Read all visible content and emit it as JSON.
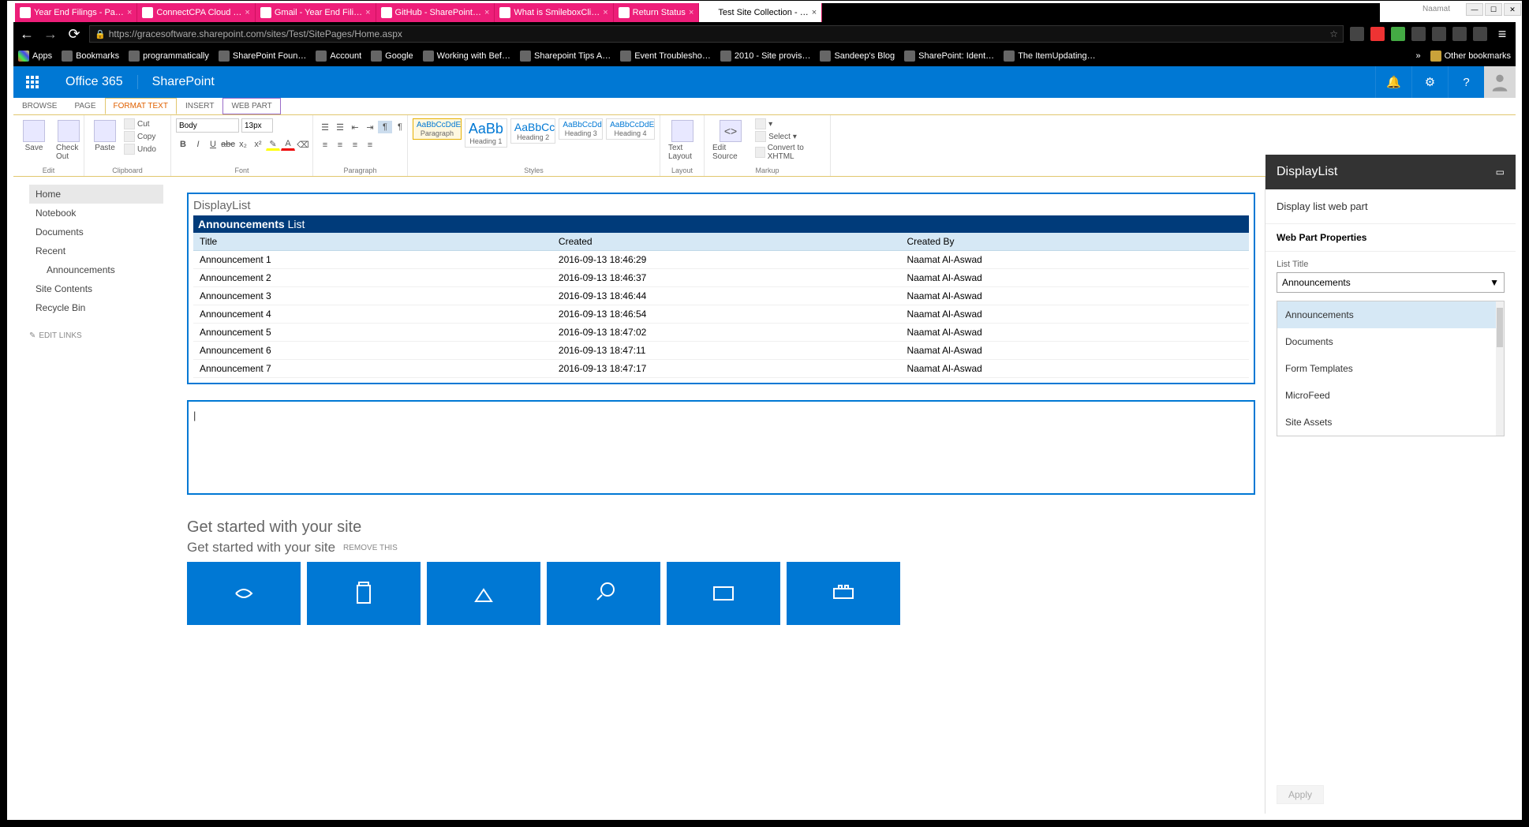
{
  "window": {
    "title": "Naamat"
  },
  "browserTabs": [
    {
      "label": "Year End Filings - Pa…"
    },
    {
      "label": "ConnectCPA Cloud …"
    },
    {
      "label": "Gmail - Year End Fili…"
    },
    {
      "label": "GitHub - SharePoint…"
    },
    {
      "label": "What is SmileboxCli…"
    },
    {
      "label": "Return Status"
    },
    {
      "label": "Test Site Collection - …"
    }
  ],
  "url": "https://gracesoftware.sharepoint.com/sites/Test/SitePages/Home.aspx",
  "bookmarks": {
    "apps": "Apps",
    "items": [
      "Bookmarks",
      "programmatically",
      "SharePoint Foun…",
      "Account",
      "Google",
      "Working with Bef…",
      "Sharepoint Tips A…",
      "Event Troublesho…",
      "2010 - Site provis…",
      "Sandeep's Blog",
      "SharePoint: Ident…",
      "The ItemUpdating…"
    ],
    "other": "Other bookmarks"
  },
  "o365": {
    "brand": "Office 365",
    "app": "SharePoint"
  },
  "ribbonTabs": [
    "BROWSE",
    "PAGE",
    "FORMAT TEXT",
    "INSERT",
    "WEB PART"
  ],
  "ribbon": {
    "edit": {
      "save": "Save",
      "checkout": "Check Out",
      "label": "Edit"
    },
    "clipboard": {
      "paste": "Paste",
      "cut": "Cut",
      "copy": "Copy",
      "undo": "Undo",
      "label": "Clipboard"
    },
    "font": {
      "family": "Body",
      "size": "13px",
      "label": "Font"
    },
    "paragraph": {
      "label": "Paragraph"
    },
    "styles": {
      "items": [
        {
          "prev": "AaBbCcDdE",
          "lab": "Paragraph"
        },
        {
          "prev": "AaBb",
          "lab": "Heading 1"
        },
        {
          "prev": "AaBbCc",
          "lab": "Heading 2"
        },
        {
          "prev": "AaBbCcDd",
          "lab": "Heading 3"
        },
        {
          "prev": "AaBbCcDdE",
          "lab": "Heading 4"
        }
      ],
      "label": "Styles"
    },
    "layout": {
      "text": "Text Layout",
      "label": "Layout"
    },
    "markup": {
      "edit": "Edit Source",
      "select": "Select",
      "convert": "Convert to XHTML",
      "label": "Markup"
    }
  },
  "leftNav": {
    "items": [
      "Home",
      "Notebook",
      "Documents",
      "Recent"
    ],
    "sub": "Announcements",
    "items2": [
      "Site Contents",
      "Recycle Bin"
    ],
    "edit": "EDIT LINKS"
  },
  "webpart": {
    "title": "DisplayList",
    "listName": "Announcements",
    "listSuffix": "List",
    "cols": [
      "Title",
      "Created",
      "Created By"
    ],
    "rows": [
      [
        "Announcement 1",
        "2016-09-13 18:46:29",
        "Naamat Al-Aswad"
      ],
      [
        "Announcement 2",
        "2016-09-13 18:46:37",
        "Naamat Al-Aswad"
      ],
      [
        "Announcement 3",
        "2016-09-13 18:46:44",
        "Naamat Al-Aswad"
      ],
      [
        "Announcement 4",
        "2016-09-13 18:46:54",
        "Naamat Al-Aswad"
      ],
      [
        "Announcement 5",
        "2016-09-13 18:47:02",
        "Naamat Al-Aswad"
      ],
      [
        "Announcement 6",
        "2016-09-13 18:47:11",
        "Naamat Al-Aswad"
      ],
      [
        "Announcement 7",
        "2016-09-13 18:47:17",
        "Naamat Al-Aswad"
      ]
    ]
  },
  "getStarted": {
    "title": "Get started with your site",
    "sub": "Get started with your site",
    "remove": "REMOVE THIS"
  },
  "propPane": {
    "title": "DisplayList",
    "desc": "Display list web part",
    "section": "Web Part Properties",
    "fieldLabel": "List Title",
    "selected": "Announcements",
    "options": [
      "Announcements",
      "Documents",
      "Form Templates",
      "MicroFeed",
      "Site Assets"
    ],
    "apply": "Apply"
  }
}
